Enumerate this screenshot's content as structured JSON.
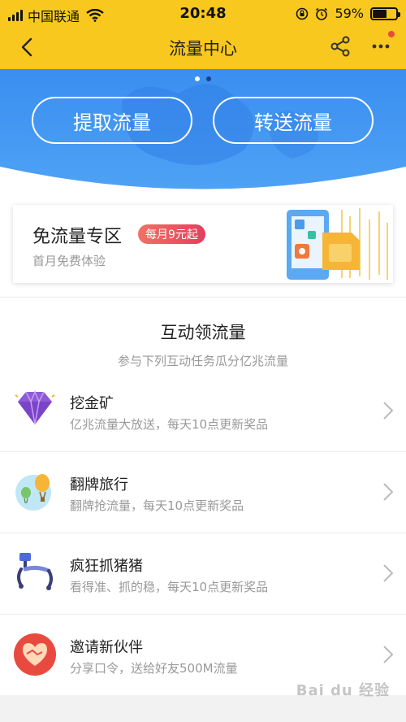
{
  "status_bar": {
    "carrier": "中国联通",
    "time": "20:48",
    "battery": "59%",
    "battery_level": 0.59
  },
  "nav": {
    "title": "流量中心",
    "back_icon": "chevron-left-icon",
    "share_icon": "share-icon",
    "more_icon": "more-dots-icon"
  },
  "banner": {
    "primary_button": "提取流量",
    "secondary_button": "转送流量",
    "page_indicator": {
      "count": 2,
      "active": 2
    },
    "colors": {
      "gradient_top": "#3a8ef0",
      "gradient_bottom": "#4ea2f5",
      "accent_dark": "#1c3f8a"
    }
  },
  "promo": {
    "title": "免流量专区",
    "badge": "每月9元起",
    "subtitle": "首月免费体验"
  },
  "section": {
    "title": "互动领流量",
    "subtitle": "参与下列互动任务瓜分亿兆流量"
  },
  "tasks": [
    {
      "name": "挖金矿",
      "desc": "亿兆流量大放送，每天10点更新奖品",
      "icon": "diamond-icon"
    },
    {
      "name": "翻牌旅行",
      "desc": "翻牌抢流量，每天10点更新奖品",
      "icon": "balloon-icon"
    },
    {
      "name": "疯狂抓猪猪",
      "desc": "看得准、抓的稳，每天10点更新奖品",
      "icon": "claw-icon"
    },
    {
      "name": "邀请新伙伴",
      "desc": "分享口令，送给好友500M流量",
      "icon": "handshake-heart-icon"
    }
  ],
  "watermark": "Bai du 经验",
  "colors": {
    "brand_yellow": "#f8c81f",
    "badge_red": "#e84a5e",
    "text_primary": "#222222",
    "text_secondary": "#999999"
  }
}
